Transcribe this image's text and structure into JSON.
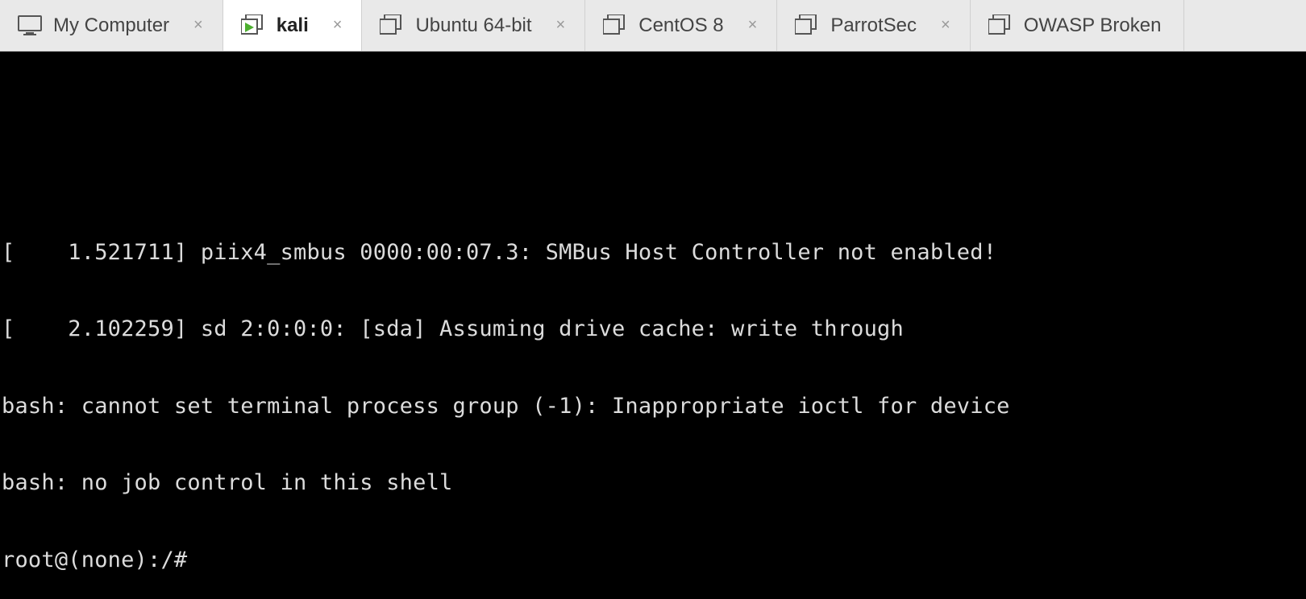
{
  "tabs": [
    {
      "label": "My Computer",
      "icon": "monitor",
      "closable": true,
      "active": false
    },
    {
      "label": "kali",
      "icon": "vm-running",
      "closable": true,
      "active": true
    },
    {
      "label": "Ubuntu 64-bit",
      "icon": "vm",
      "closable": true,
      "active": false
    },
    {
      "label": "CentOS 8",
      "icon": "vm",
      "closable": true,
      "active": false
    },
    {
      "label": "ParrotSec",
      "icon": "vm",
      "closable": true,
      "active": false
    },
    {
      "label": "OWASP Broken",
      "icon": "vm",
      "closable": false,
      "active": false
    }
  ],
  "close_glyph": "×",
  "terminal": {
    "lines": [
      "[    1.521711] piix4_smbus 0000:00:07.3: SMBus Host Controller not enabled!",
      "[    2.102259] sd 2:0:0:0: [sda] Assuming drive cache: write through",
      "bash: cannot set terminal process group (-1): Inappropriate ioctl for device",
      "bash: no job control in this shell",
      "root@(none):/#"
    ]
  }
}
